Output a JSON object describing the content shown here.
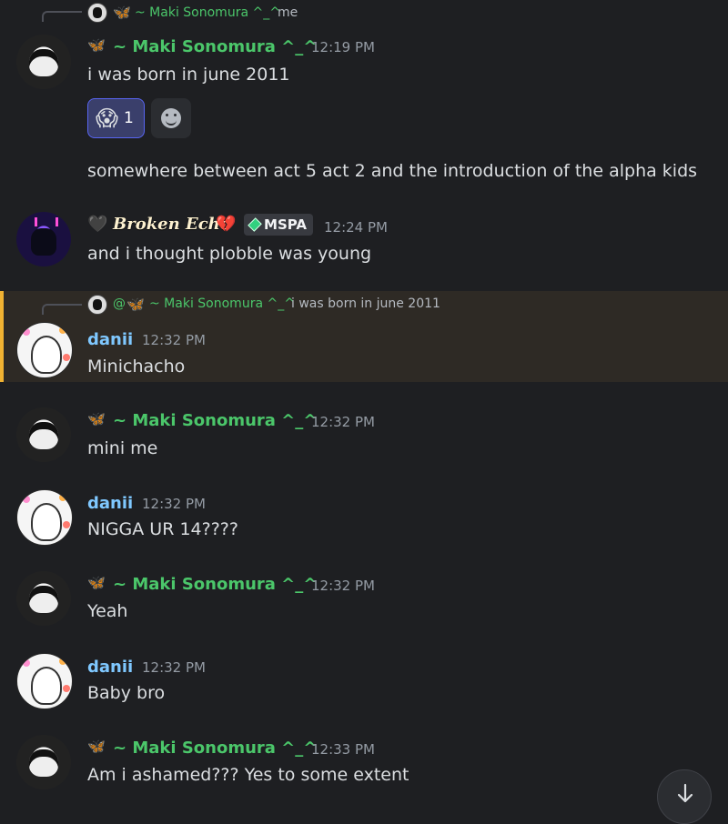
{
  "chat": {
    "reply_top": {
      "name": "~ Maki Sonomura ^_^",
      "text": "me"
    },
    "messages": [
      {
        "author": "~ Maki Sonomura ^_^",
        "time": "12:19 PM",
        "lines": [
          "i was born in june 2011"
        ],
        "reactions": [
          {
            "emoji": "😱",
            "count": "1"
          }
        ],
        "extra_line": "somewhere between act 5 act 2 and the introduction of the alpha kids"
      },
      {
        "author": "Broken Echo",
        "time": "12:24 PM",
        "badge": "MSPA",
        "lines": [
          "and i thought plobble was young"
        ]
      },
      {
        "author": "danii",
        "time": "12:32 PM",
        "reply": {
          "prefix": "@",
          "name": "~ Maki Sonomura ^_^",
          "text": "i was born in june 2011"
        },
        "lines": [
          "Minichacho"
        ]
      },
      {
        "author": "~ Maki Sonomura ^_^",
        "time": "12:32 PM",
        "lines": [
          "mini me"
        ]
      },
      {
        "author": "danii",
        "time": "12:32 PM",
        "lines": [
          "NIGGA UR 14????"
        ]
      },
      {
        "author": "~ Maki Sonomura ^_^",
        "time": "12:32 PM",
        "lines": [
          "Yeah"
        ]
      },
      {
        "author": "danii",
        "time": "12:32 PM",
        "lines": [
          "Baby bro"
        ]
      },
      {
        "author": "~ Maki Sonomura ^_^",
        "time": "12:33 PM",
        "lines": [
          "Am i ashamed??? Yes to some extent"
        ]
      }
    ]
  },
  "colors": {
    "background": "#1e1f22",
    "maki_name": "#4bc66a",
    "danii_name": "#7fc8ff",
    "highlight_bar": "#f0b232"
  },
  "icons": {
    "butterfly": "🦋",
    "black_heart": "🖤",
    "broken_heart": "💔"
  }
}
